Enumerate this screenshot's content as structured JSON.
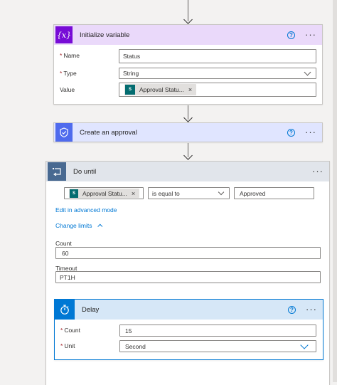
{
  "colors": {
    "variable_accent": "#770bd6",
    "variable_header_bg": "#ead9fa",
    "approval_accent": "#4f6bed",
    "approval_header_bg": "#e0e5ff",
    "control_accent": "#486991",
    "delay_accent": "#0078d4",
    "link": "#0078d4"
  },
  "initialize_variable": {
    "title": "Initialize variable",
    "icon": "braces-x-icon",
    "name_label": "Name",
    "name_value": "Status",
    "type_label": "Type",
    "type_value": "String",
    "value_label": "Value",
    "value_token": "Approval Statu..."
  },
  "create_approval": {
    "title": "Create an approval",
    "icon": "approval-icon"
  },
  "do_until": {
    "title": "Do until",
    "icon": "loop-icon",
    "condition_token": "Approval Statu...",
    "operator": "is equal to",
    "compare_value": "Approved",
    "edit_advanced_link": "Edit in advanced mode",
    "change_limits_link": "Change limits",
    "count_label": "Count",
    "count_value": "60",
    "timeout_label": "Timeout",
    "timeout_value": "PT1H"
  },
  "delay": {
    "title": "Delay",
    "icon": "stopwatch-icon",
    "count_label": "Count",
    "count_value": "15",
    "unit_label": "Unit",
    "unit_value": "Second"
  },
  "common": {
    "help_glyph": "?",
    "more_glyph": "···",
    "required_marker": "*",
    "token_remove": "×"
  }
}
